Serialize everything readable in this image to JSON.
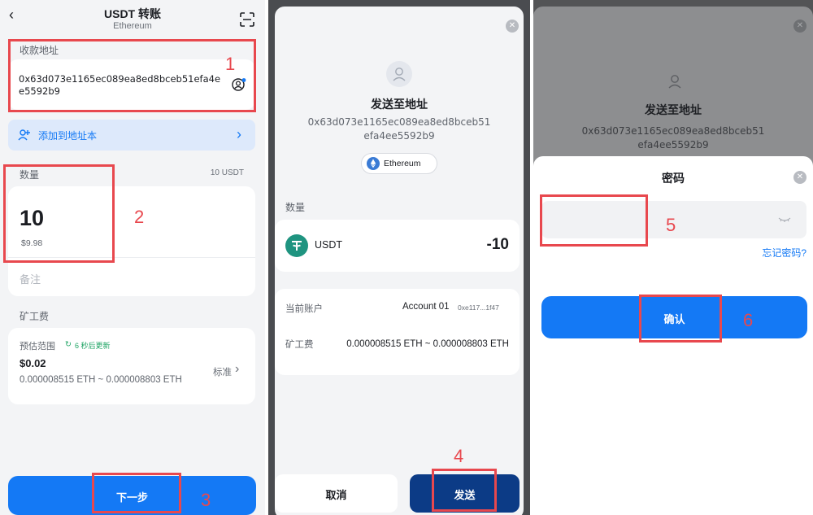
{
  "screen1": {
    "title": "USDT 转账",
    "subtitle": "Ethereum",
    "address_label": "收款地址",
    "address": "0x63d073e1165ec089ea8ed8bceb51efa4ee5592b9",
    "add_to_book": "添加到地址本",
    "amount_label": "数量",
    "amount_unit": "10 USDT",
    "amount_value": "10",
    "amount_fiat": "$9.98",
    "memo_placeholder": "备注",
    "fee_label": "矿工费",
    "fee_range_label": "预估范围",
    "fee_refresh": "6 秒后更新",
    "fee_usd": "$0.02",
    "fee_eth": "0.000008515 ETH ~ 0.000008803 ETH",
    "fee_speed": "标准",
    "next_button": "下一步",
    "steps": [
      "1",
      "2",
      "3"
    ]
  },
  "screen2": {
    "heading": "发送至地址",
    "address_line1": "0x63d073e1165ec089ea8ed8bceb51",
    "address_line2": "efa4ee5592b9",
    "network": "Ethereum",
    "amount_label": "数量",
    "token": "USDT",
    "amount": "-10",
    "account_label": "当前账户",
    "account_name": "Account 01",
    "account_short": "0xe117...1f47",
    "fee_label": "矿工费",
    "fee_value": "0.000008515 ETH ~ 0.000008803 ETH",
    "cancel_button": "取消",
    "send_button": "发送",
    "step": "4"
  },
  "screen3": {
    "heading": "发送至地址",
    "address_line1": "0x63d073e1165ec089ea8ed8bceb51",
    "address_line2": "efa4ee5592b9",
    "password_title": "密码",
    "forgot_password": "忘记密码?",
    "confirm_button": "确认",
    "steps": [
      "5",
      "6"
    ]
  },
  "colors": {
    "accent": "#1479f5",
    "highlight": "#e8484e",
    "dark_button": "#0c3b86",
    "usdt_green": "#1f9480"
  }
}
